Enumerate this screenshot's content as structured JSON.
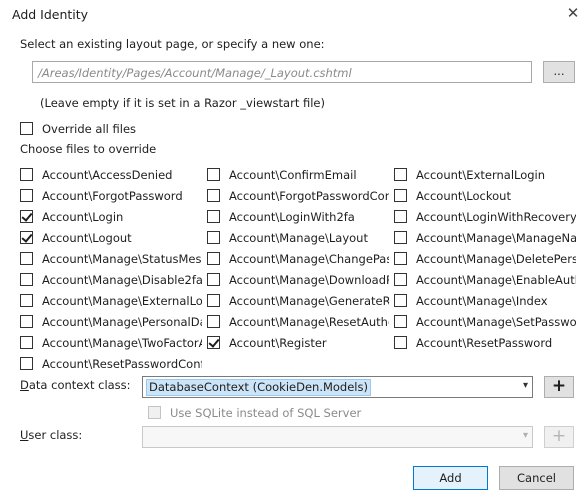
{
  "window": {
    "title": "Add Identity",
    "close_glyph": "✕"
  },
  "layout": {
    "prompt": "Select an existing layout page, or specify a new one:",
    "path_placeholder": "/Areas/Identity/Pages/Account/Manage/_Layout.cshtml",
    "browse_label": "...",
    "hint": "(Leave empty if it is set in a Razor _viewstart file)"
  },
  "override_all": {
    "label": "Override all files",
    "checked": false
  },
  "choose_label": "Choose files to override",
  "files": {
    "col1": [
      {
        "label": "Account\\AccessDenied",
        "checked": false
      },
      {
        "label": "Account\\ForgotPassword",
        "checked": false
      },
      {
        "label": "Account\\Login",
        "checked": true
      },
      {
        "label": "Account\\Logout",
        "checked": true
      },
      {
        "label": "Account\\Manage\\StatusMessa",
        "checked": false
      },
      {
        "label": "Account\\Manage\\Disable2fa",
        "checked": false
      },
      {
        "label": "Account\\Manage\\ExternalLog",
        "checked": false
      },
      {
        "label": "Account\\Manage\\PersonalDat",
        "checked": false
      },
      {
        "label": "Account\\Manage\\TwoFactorA",
        "checked": false
      },
      {
        "label": "Account\\ResetPasswordConfir",
        "checked": false
      }
    ],
    "col2": [
      {
        "label": "Account\\ConfirmEmail",
        "checked": false
      },
      {
        "label": "Account\\ForgotPasswordConf",
        "checked": false
      },
      {
        "label": "Account\\LoginWith2fa",
        "checked": false
      },
      {
        "label": "Account\\Manage\\Layout",
        "checked": false
      },
      {
        "label": "Account\\Manage\\ChangePass",
        "checked": false
      },
      {
        "label": "Account\\Manage\\DownloadP",
        "checked": false
      },
      {
        "label": "Account\\Manage\\GenerateRe",
        "checked": false
      },
      {
        "label": "Account\\Manage\\ResetAuther",
        "checked": false
      },
      {
        "label": "Account\\Register",
        "checked": true
      }
    ],
    "col3": [
      {
        "label": "Account\\ExternalLogin",
        "checked": false
      },
      {
        "label": "Account\\Lockout",
        "checked": false
      },
      {
        "label": "Account\\LoginWithRecoveryC",
        "checked": false
      },
      {
        "label": "Account\\Manage\\ManageNav",
        "checked": false
      },
      {
        "label": "Account\\Manage\\DeletePerso",
        "checked": false
      },
      {
        "label": "Account\\Manage\\EnableAuth",
        "checked": false
      },
      {
        "label": "Account\\Manage\\Index",
        "checked": false
      },
      {
        "label": "Account\\Manage\\SetPasswor",
        "checked": false
      },
      {
        "label": "Account\\ResetPassword",
        "checked": false
      }
    ]
  },
  "data_context": {
    "label": "Data context class:",
    "value": "DatabaseContext (CookieDen.Models)",
    "add_glyph": "+",
    "arrow_glyph": "⌄"
  },
  "sqlite": {
    "label": "Use SQLite instead of SQL Server",
    "checked": false,
    "disabled": true
  },
  "user_class": {
    "label": "User class:",
    "value": "",
    "add_glyph": "+"
  },
  "buttons": {
    "add": "Add",
    "cancel": "Cancel"
  }
}
